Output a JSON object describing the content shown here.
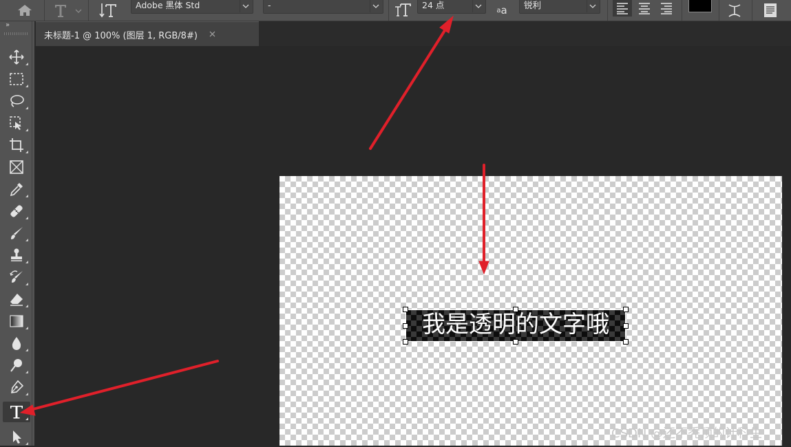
{
  "options_bar": {
    "font_family": "Adobe 黑体 Std",
    "font_style": "-",
    "font_size": "24 点",
    "anti_alias_icon_label": "a",
    "anti_alias_icon_label_large": "a",
    "anti_alias": "锐利",
    "text_color": "#000000"
  },
  "document_tab": {
    "title": "未标题-1 @ 100% (图层 1, RGB/8#)",
    "close": "×"
  },
  "toolbar": {
    "collapse_label": "»",
    "active_tool": "type-tool"
  },
  "canvas": {
    "layer_text": "我是透明的文字哦"
  },
  "watermark": "CSDN @还不秃顶的计科生",
  "colors": {
    "panel": "#535353",
    "workspace": "#282828",
    "annotation_arrow": "#e0202a"
  },
  "icons": [
    "home-icon",
    "type-tool-icon",
    "text-orientation-icon",
    "font-size-icon",
    "anti-alias-icon",
    "align-left-icon",
    "align-center-icon",
    "align-right-icon",
    "warp-text-icon",
    "character-panel-icon",
    "move-icon",
    "marquee-icon",
    "lasso-icon",
    "object-select-icon",
    "crop-icon",
    "frame-icon",
    "eyedropper-icon",
    "healing-brush-icon",
    "brush-icon",
    "clone-stamp-icon",
    "history-brush-icon",
    "eraser-icon",
    "gradient-icon",
    "blur-icon",
    "dodge-icon",
    "pen-icon",
    "type-icon",
    "path-select-icon"
  ]
}
